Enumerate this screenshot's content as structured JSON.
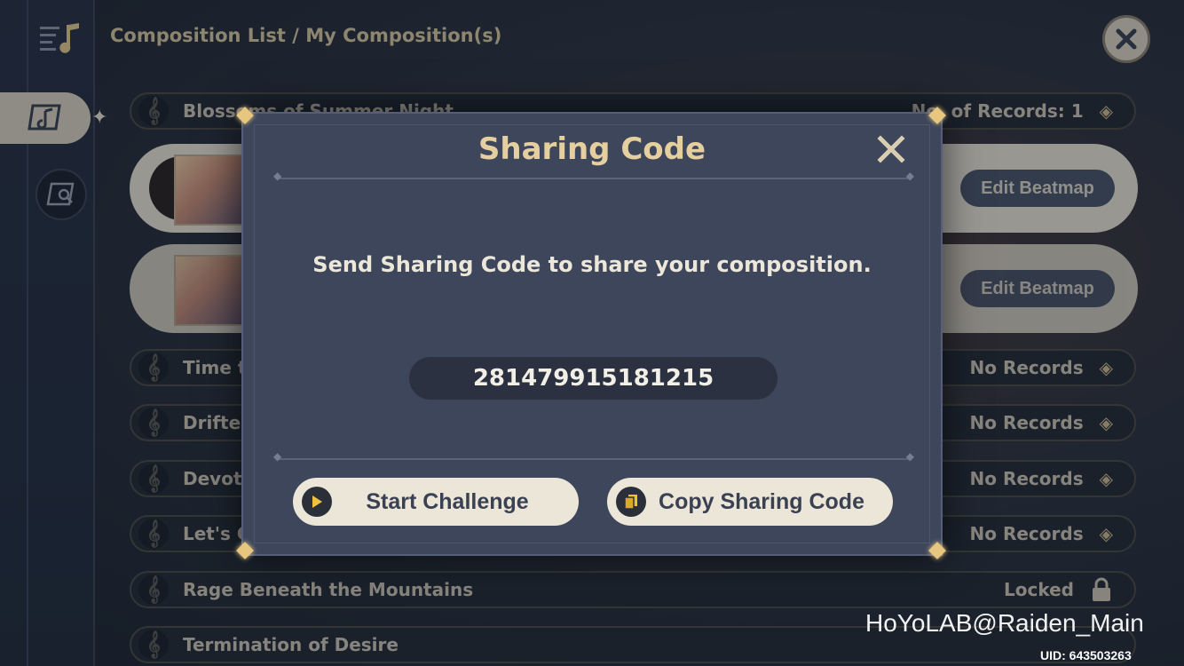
{
  "breadcrumb": "Composition List / My Composition(s)",
  "list": {
    "rows": [
      {
        "title": "Blossoms of Summer Night",
        "status": "No. of Records: 1"
      },
      {
        "title": "Time t",
        "status": "No Records"
      },
      {
        "title": "Drifter",
        "status": "No Records"
      },
      {
        "title": "Devoti",
        "status": "No Records"
      },
      {
        "title": "Let's G",
        "status": "No Records"
      },
      {
        "title": "Rage Beneath the Mountains",
        "status": "Locked"
      },
      {
        "title": "Termination of Desire",
        "status": ""
      }
    ],
    "cards": [
      {
        "button": "Edit Beatmap"
      },
      {
        "button": "Edit Beatmap"
      }
    ]
  },
  "modal": {
    "title": "Sharing Code",
    "message": "Send Sharing Code to share your composition.",
    "code": "281479915181215",
    "start_label": "Start Challenge",
    "copy_label": "Copy Sharing Code"
  },
  "watermark": "HoYoLAB@Raiden_Main",
  "uid": "UID: 643503263",
  "colors": {
    "accent_gold": "#e6cf9f",
    "modal_bg": "#3e465b",
    "button_bg": "#ece6d8"
  }
}
